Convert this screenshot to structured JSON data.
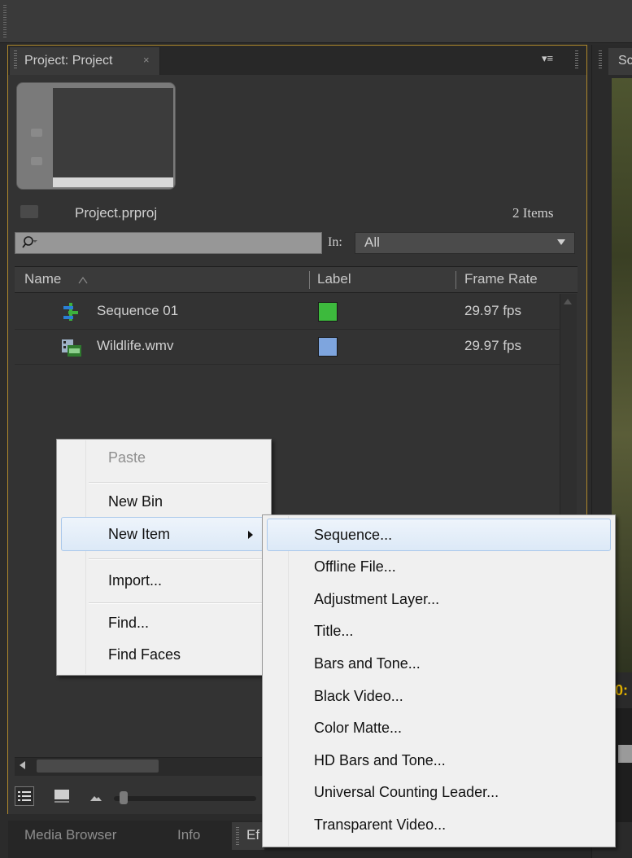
{
  "project_panel": {
    "tab_label": "Project: Project",
    "tab_close": "×",
    "panel_menu": "▾≡",
    "project_file": "Project.prproj",
    "items_count": "2 Items",
    "search": {
      "value": ""
    },
    "in_label": "In:",
    "in_value": "All",
    "columns": [
      "Name",
      "Label",
      "Frame Rate"
    ],
    "rows": [
      {
        "name": "Sequence 01",
        "icon": "sequence-icon",
        "label_color": "#3dba3d",
        "frame_rate": "29.97 fps"
      },
      {
        "name": "Wildlife.wmv",
        "icon": "video-clip-icon",
        "label_color": "#7ea5de",
        "frame_rate": "29.97 fps"
      }
    ]
  },
  "bottom_tabs": [
    "Media Browser",
    "Info",
    "Ef"
  ],
  "right_panel": {
    "tab_label": "Sc",
    "timecode_fragment": "0:"
  },
  "context_menu": {
    "items": [
      "Paste",
      "New Bin",
      "New Item",
      "Import...",
      "Find...",
      "Find Faces"
    ],
    "disabled": [
      "Paste"
    ],
    "highlighted": "New Item"
  },
  "new_item_submenu": {
    "items": [
      "Sequence...",
      "Offline File...",
      "Adjustment Layer...",
      "Title...",
      "Bars and Tone...",
      "Black Video...",
      "Color Matte...",
      "HD Bars and Tone...",
      "Universal Counting Leader...",
      "Transparent Video..."
    ],
    "highlighted": "Sequence..."
  },
  "colors": {
    "panel_focus_border": "#b0892c",
    "menu_highlight": "#dce9f7",
    "timecode": "#e5b400"
  }
}
